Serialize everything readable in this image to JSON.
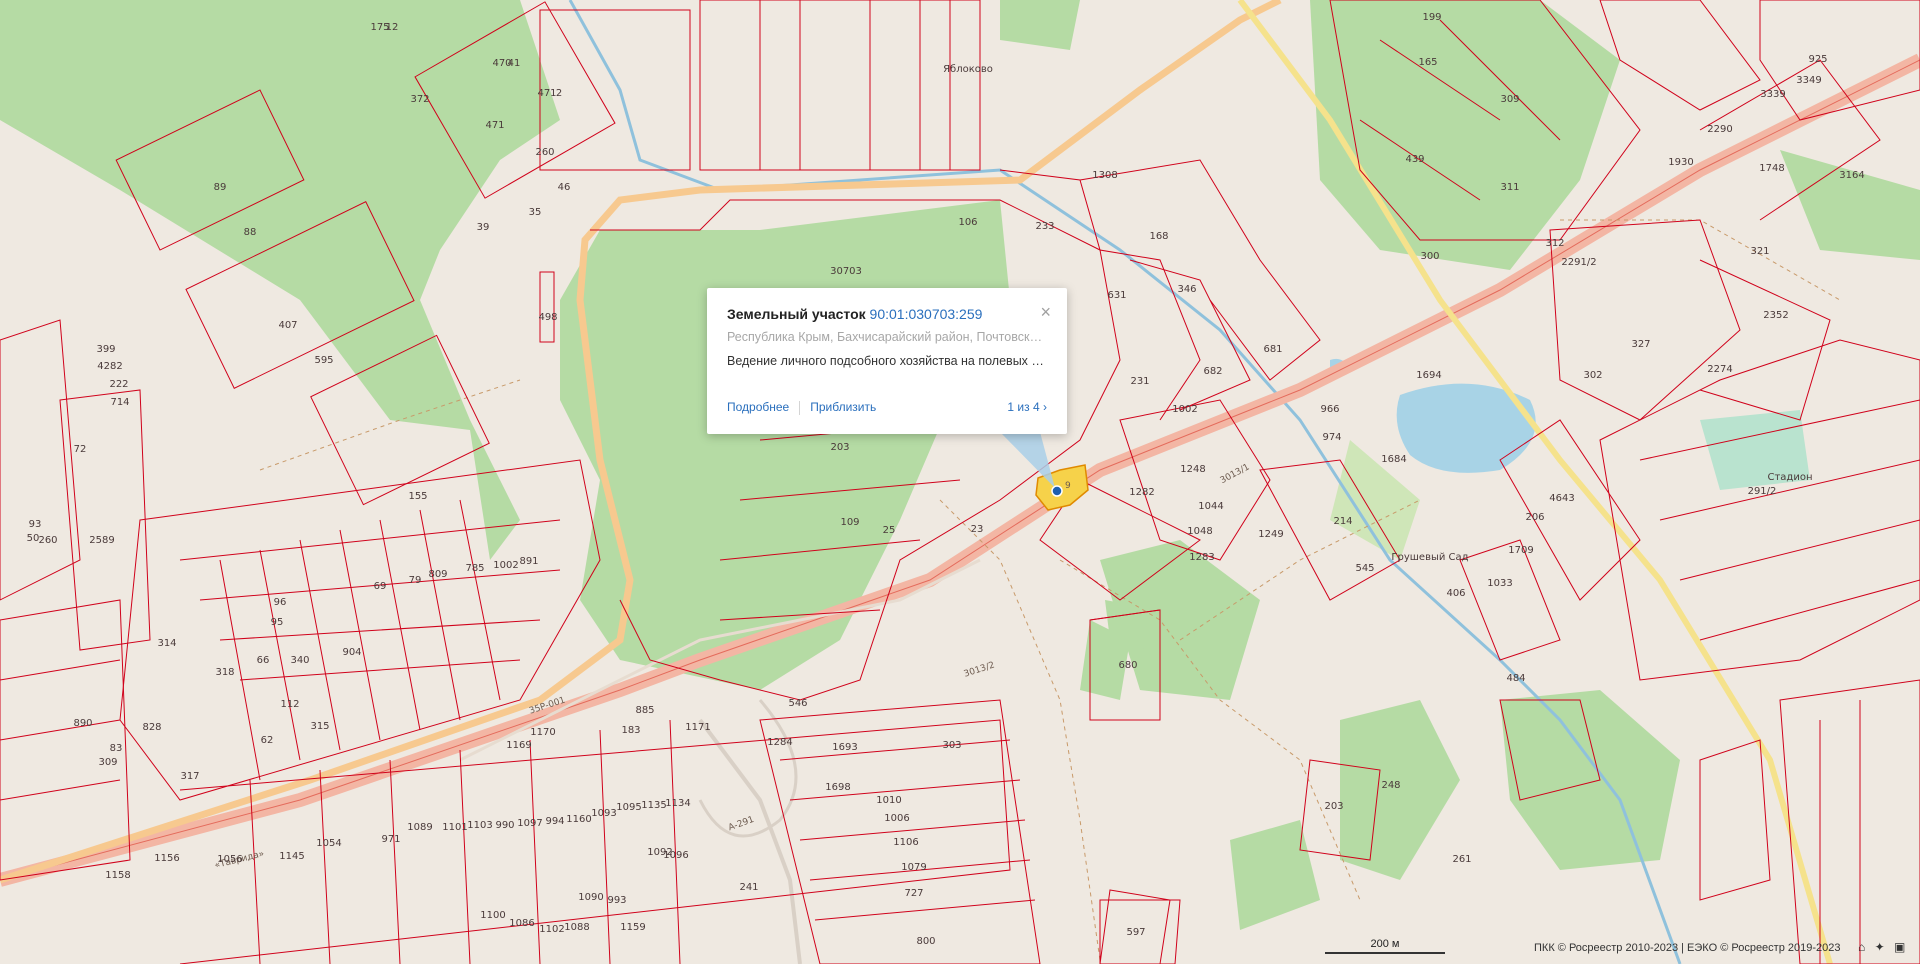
{
  "map": {
    "places": [
      "Яблоково",
      "Грушевый Сад",
      "Стадион"
    ],
    "road_names": [
      "«Таврида»",
      "А-291",
      "35Р-001",
      "3013/2",
      "3013/1"
    ],
    "parcels": [
      "175",
      "470",
      "471",
      "471",
      "260",
      "46",
      "372",
      "89",
      "88",
      "407",
      "595",
      "155",
      "498",
      "39",
      "35",
      "106",
      "233",
      "1308",
      "168",
      "30703",
      "631",
      "346",
      "681",
      "231",
      "682",
      "1002",
      "1248",
      "1282",
      "1044",
      "1048",
      "1249",
      "1283",
      "214",
      "545",
      "439",
      "309",
      "311",
      "300",
      "312",
      "327",
      "2352",
      "2274",
      "302",
      "321",
      "966",
      "974",
      "1694",
      "1684",
      "199",
      "165",
      "203",
      "109",
      "25",
      "23",
      "680",
      "546",
      "1171",
      "1284",
      "1693",
      "1698",
      "303",
      "1010",
      "1006",
      "1106",
      "1079",
      "727",
      "800",
      "241",
      "1158",
      "1156",
      "971",
      "1056",
      "1145",
      "1054",
      "1089",
      "1101",
      "1103",
      "990",
      "1097",
      "994",
      "1160",
      "1093",
      "1095",
      "1135",
      "1134",
      "1092",
      "1096",
      "1090",
      "993",
      "1100",
      "1086",
      "1102",
      "1088",
      "1159",
      "183",
      "1170",
      "1169",
      "203",
      "248",
      "261",
      "597",
      "406",
      "484",
      "206",
      "1709",
      "1033",
      "925",
      "3349",
      "3339",
      "2290",
      "1748",
      "1930",
      "3164",
      "2291/2",
      "291/2",
      "4643",
      "399",
      "4282",
      "222",
      "714",
      "72",
      "93",
      "50",
      "260",
      "2589",
      "69",
      "79",
      "809",
      "785",
      "891",
      "1002",
      "96",
      "95",
      "66",
      "904",
      "318",
      "340",
      "112",
      "828",
      "890",
      "314",
      "83",
      "309",
      "62",
      "317",
      "315",
      "885",
      "12",
      "41",
      "2"
    ],
    "highlighted_parcel_number": "9"
  },
  "popup": {
    "title": "Земельный участок",
    "cadastral_number": "90:01:030703:259",
    "address": "Республика Крым, Бахчисарайский район, Почтовское сельское поселение",
    "purpose": "Ведение личного подсобного хозяйства на полевых участках",
    "details_label": "Подробнее",
    "zoom_label": "Приблизить",
    "pager": "1 из 4",
    "close": "×"
  },
  "footer": {
    "scale": "200 м",
    "copyright": "ПКК © Росреестр 2010-2023 | ЕЭКО © Росреестр 2019-2023",
    "controls": [
      "⌂",
      "✦",
      "▣"
    ]
  },
  "colors": {
    "background": "#efe9e1",
    "forest": "#b5dba4",
    "parcel_border": "#d0021b",
    "road": "#f3b6a4",
    "water": "#a8d3e6",
    "highlight": "#f6d24a",
    "link": "#2a6fbd"
  }
}
